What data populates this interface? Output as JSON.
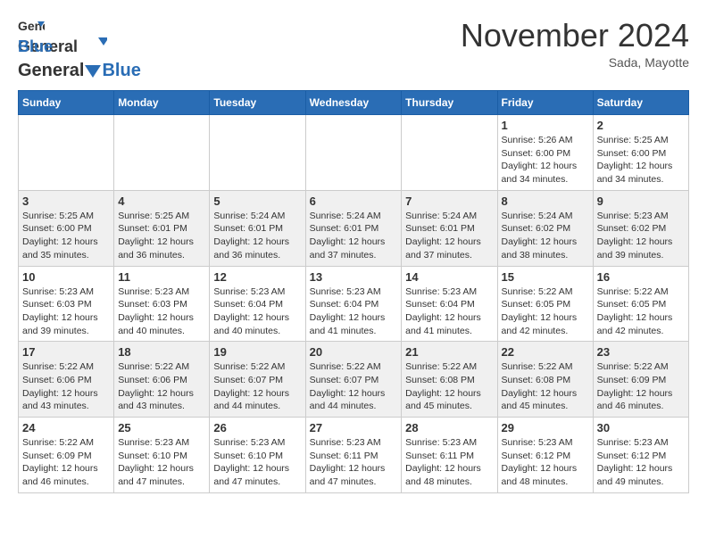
{
  "header": {
    "logo_general": "General",
    "logo_blue": "Blue",
    "month_title": "November 2024",
    "location": "Sada, Mayotte"
  },
  "days_of_week": [
    "Sunday",
    "Monday",
    "Tuesday",
    "Wednesday",
    "Thursday",
    "Friday",
    "Saturday"
  ],
  "weeks": [
    {
      "days": [
        {
          "date": "",
          "info": ""
        },
        {
          "date": "",
          "info": ""
        },
        {
          "date": "",
          "info": ""
        },
        {
          "date": "",
          "info": ""
        },
        {
          "date": "",
          "info": ""
        },
        {
          "date": "1",
          "info": "Sunrise: 5:26 AM\nSunset: 6:00 PM\nDaylight: 12 hours\nand 34 minutes."
        },
        {
          "date": "2",
          "info": "Sunrise: 5:25 AM\nSunset: 6:00 PM\nDaylight: 12 hours\nand 34 minutes."
        }
      ]
    },
    {
      "days": [
        {
          "date": "3",
          "info": "Sunrise: 5:25 AM\nSunset: 6:00 PM\nDaylight: 12 hours\nand 35 minutes."
        },
        {
          "date": "4",
          "info": "Sunrise: 5:25 AM\nSunset: 6:01 PM\nDaylight: 12 hours\nand 36 minutes."
        },
        {
          "date": "5",
          "info": "Sunrise: 5:24 AM\nSunset: 6:01 PM\nDaylight: 12 hours\nand 36 minutes."
        },
        {
          "date": "6",
          "info": "Sunrise: 5:24 AM\nSunset: 6:01 PM\nDaylight: 12 hours\nand 37 minutes."
        },
        {
          "date": "7",
          "info": "Sunrise: 5:24 AM\nSunset: 6:01 PM\nDaylight: 12 hours\nand 37 minutes."
        },
        {
          "date": "8",
          "info": "Sunrise: 5:24 AM\nSunset: 6:02 PM\nDaylight: 12 hours\nand 38 minutes."
        },
        {
          "date": "9",
          "info": "Sunrise: 5:23 AM\nSunset: 6:02 PM\nDaylight: 12 hours\nand 39 minutes."
        }
      ]
    },
    {
      "days": [
        {
          "date": "10",
          "info": "Sunrise: 5:23 AM\nSunset: 6:03 PM\nDaylight: 12 hours\nand 39 minutes."
        },
        {
          "date": "11",
          "info": "Sunrise: 5:23 AM\nSunset: 6:03 PM\nDaylight: 12 hours\nand 40 minutes."
        },
        {
          "date": "12",
          "info": "Sunrise: 5:23 AM\nSunset: 6:04 PM\nDaylight: 12 hours\nand 40 minutes."
        },
        {
          "date": "13",
          "info": "Sunrise: 5:23 AM\nSunset: 6:04 PM\nDaylight: 12 hours\nand 41 minutes."
        },
        {
          "date": "14",
          "info": "Sunrise: 5:23 AM\nSunset: 6:04 PM\nDaylight: 12 hours\nand 41 minutes."
        },
        {
          "date": "15",
          "info": "Sunrise: 5:22 AM\nSunset: 6:05 PM\nDaylight: 12 hours\nand 42 minutes."
        },
        {
          "date": "16",
          "info": "Sunrise: 5:22 AM\nSunset: 6:05 PM\nDaylight: 12 hours\nand 42 minutes."
        }
      ]
    },
    {
      "days": [
        {
          "date": "17",
          "info": "Sunrise: 5:22 AM\nSunset: 6:06 PM\nDaylight: 12 hours\nand 43 minutes."
        },
        {
          "date": "18",
          "info": "Sunrise: 5:22 AM\nSunset: 6:06 PM\nDaylight: 12 hours\nand 43 minutes."
        },
        {
          "date": "19",
          "info": "Sunrise: 5:22 AM\nSunset: 6:07 PM\nDaylight: 12 hours\nand 44 minutes."
        },
        {
          "date": "20",
          "info": "Sunrise: 5:22 AM\nSunset: 6:07 PM\nDaylight: 12 hours\nand 44 minutes."
        },
        {
          "date": "21",
          "info": "Sunrise: 5:22 AM\nSunset: 6:08 PM\nDaylight: 12 hours\nand 45 minutes."
        },
        {
          "date": "22",
          "info": "Sunrise: 5:22 AM\nSunset: 6:08 PM\nDaylight: 12 hours\nand 45 minutes."
        },
        {
          "date": "23",
          "info": "Sunrise: 5:22 AM\nSunset: 6:09 PM\nDaylight: 12 hours\nand 46 minutes."
        }
      ]
    },
    {
      "days": [
        {
          "date": "24",
          "info": "Sunrise: 5:22 AM\nSunset: 6:09 PM\nDaylight: 12 hours\nand 46 minutes."
        },
        {
          "date": "25",
          "info": "Sunrise: 5:23 AM\nSunset: 6:10 PM\nDaylight: 12 hours\nand 47 minutes."
        },
        {
          "date": "26",
          "info": "Sunrise: 5:23 AM\nSunset: 6:10 PM\nDaylight: 12 hours\nand 47 minutes."
        },
        {
          "date": "27",
          "info": "Sunrise: 5:23 AM\nSunset: 6:11 PM\nDaylight: 12 hours\nand 47 minutes."
        },
        {
          "date": "28",
          "info": "Sunrise: 5:23 AM\nSunset: 6:11 PM\nDaylight: 12 hours\nand 48 minutes."
        },
        {
          "date": "29",
          "info": "Sunrise: 5:23 AM\nSunset: 6:12 PM\nDaylight: 12 hours\nand 48 minutes."
        },
        {
          "date": "30",
          "info": "Sunrise: 5:23 AM\nSunset: 6:12 PM\nDaylight: 12 hours\nand 49 minutes."
        }
      ]
    }
  ]
}
